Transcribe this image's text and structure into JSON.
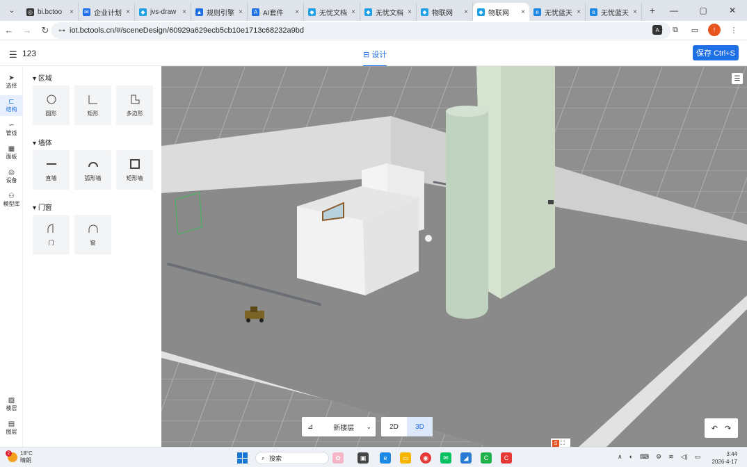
{
  "browser": {
    "tabs": [
      {
        "title": "bi.bctoo",
        "fav_color": "#333333",
        "fav_glyph": "◎",
        "active": false
      },
      {
        "title": "企业计划",
        "fav_color": "#1f6fe5",
        "fav_glyph": "✉",
        "active": false
      },
      {
        "title": "jvs-draw",
        "fav_color": "#1f9fe5",
        "fav_glyph": "◆",
        "active": false
      },
      {
        "title": "规则引擎",
        "fav_color": "#1f6fe5",
        "fav_glyph": "▲",
        "active": false
      },
      {
        "title": "AI套件",
        "fav_color": "#1f6fe5",
        "fav_glyph": "A",
        "active": false
      },
      {
        "title": "无忧文档",
        "fav_color": "#1f9fe5",
        "fav_glyph": "◆",
        "active": false
      },
      {
        "title": "无忧文档",
        "fav_color": "#1f9fe5",
        "fav_glyph": "◆",
        "active": false
      },
      {
        "title": "物联网",
        "fav_color": "#1f9fe5",
        "fav_glyph": "◆",
        "active": false
      },
      {
        "title": "物联网",
        "fav_color": "#1f9fe5",
        "fav_glyph": "◆",
        "active": true
      },
      {
        "title": "无忧蓝天",
        "fav_color": "#1e88e5",
        "fav_glyph": "e",
        "active": false
      },
      {
        "title": "无忧蓝天",
        "fav_color": "#1e88e5",
        "fav_glyph": "e",
        "active": false
      }
    ],
    "tab_close": "×",
    "new_tab": "+",
    "url": "iot.bctools.cn/#/sceneDesign/60929a629ecb5cb10e1713c68232a9bd",
    "profile_initial": "!"
  },
  "app": {
    "project_name": "123",
    "design_tab_label": "设计",
    "design_tab_icon": "⊟",
    "save_label": "保存 Ctrl+S"
  },
  "rail": {
    "items": [
      {
        "label": "选择",
        "icon": "➤",
        "active": false
      },
      {
        "label": "结构",
        "icon": "⊏",
        "active": true
      },
      {
        "label": "管线",
        "icon": "∽",
        "active": false
      },
      {
        "label": "面板",
        "icon": "▦",
        "active": false
      },
      {
        "label": "设备",
        "icon": "◎",
        "active": false
      },
      {
        "label": "模型库",
        "icon": "⚇",
        "active": false
      }
    ],
    "bottom_items": [
      {
        "label": "楼层",
        "icon": "▨"
      },
      {
        "label": "图层",
        "icon": "▤"
      }
    ]
  },
  "panel": {
    "sections": [
      {
        "title": "区域",
        "tools": [
          "圆形",
          "矩形",
          "多边形"
        ]
      },
      {
        "title": "墙体",
        "tools": [
          "直墙",
          "弧形墙",
          "矩形墙"
        ]
      },
      {
        "title": "门窗",
        "tools": [
          "门",
          "窗"
        ]
      }
    ]
  },
  "viewport": {
    "layer_name": "新楼层",
    "mode_2d": "2D",
    "mode_3d": "3D",
    "active_mode": "3D",
    "undo": "↶",
    "redo": "↷",
    "logo_text": "S",
    "logo_glyphs": "⛶"
  },
  "taskbar": {
    "weather_temp": "18°C",
    "weather_desc": "晴朗",
    "weather_badge": "2",
    "search_label": "搜索",
    "time": "3:44",
    "date": "2026-4-17"
  }
}
